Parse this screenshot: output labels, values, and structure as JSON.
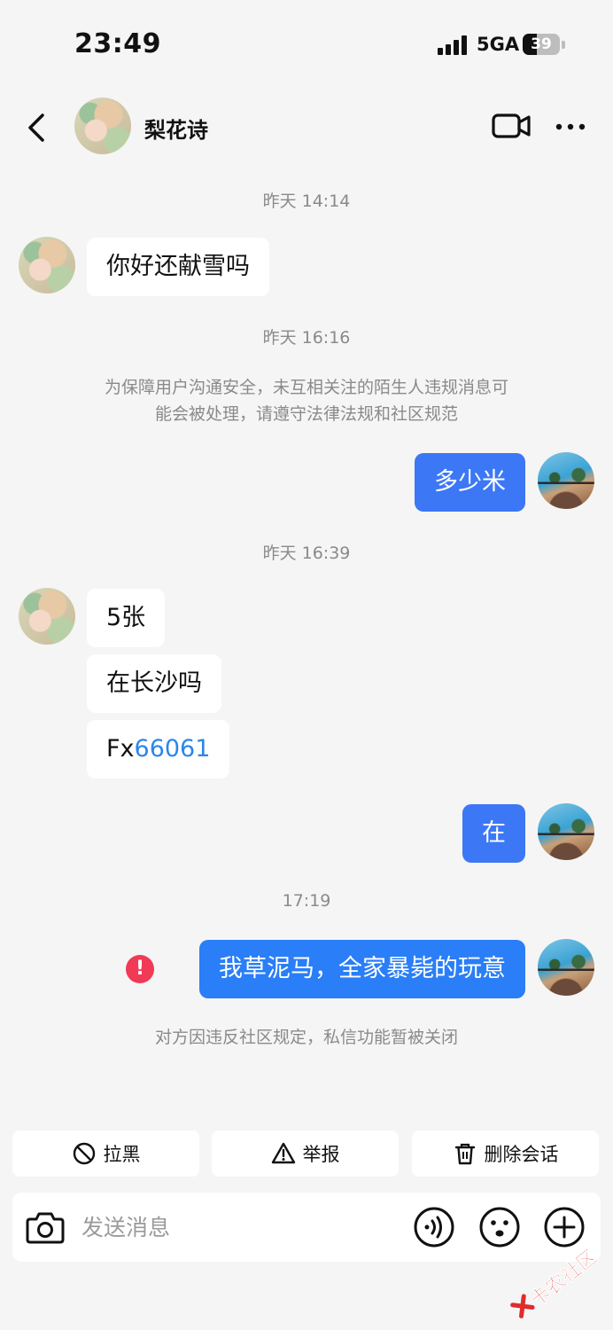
{
  "status_bar": {
    "time": "23:49",
    "network": "5GA",
    "battery": "39",
    "battery_level": 0.39
  },
  "header": {
    "contact_name": "梨花诗",
    "icons": [
      "back-icon",
      "video-call-icon",
      "more-icon"
    ]
  },
  "chat": {
    "timestamps": [
      "昨天 14:14",
      "昨天 16:16",
      "昨天 16:39",
      "17:19"
    ],
    "msg_hello": "你好还献雪吗",
    "safety_notice_line1": "为保障用户沟通安全，未互相关注的陌生人违规消息可",
    "safety_notice_line2": "能会被处理，请遵守法律法规和社区规范",
    "msg_how_much": "多少米",
    "msg_five": "5张",
    "msg_changsha": "在长沙吗",
    "msg_fx_prefix": "Fx",
    "msg_fx_number": "66061",
    "msg_zai": "在",
    "msg_failed": "我草泥马，全家暴毙的玩意",
    "error_mark": "!",
    "closed_notice": "对方因违反社区规定，私信功能暂被关闭"
  },
  "actions": {
    "block": "拉黑",
    "report": "举报",
    "delete": "删除会话"
  },
  "input": {
    "placeholder": "发送消息"
  },
  "watermark": {
    "text": "卡农社区"
  },
  "colors": {
    "background": "#f5f5f5",
    "outgoing_bubble": "#3c78f5",
    "incoming_bubble": "#ffffff",
    "link": "#2b86e8",
    "error": "#f03a56"
  }
}
